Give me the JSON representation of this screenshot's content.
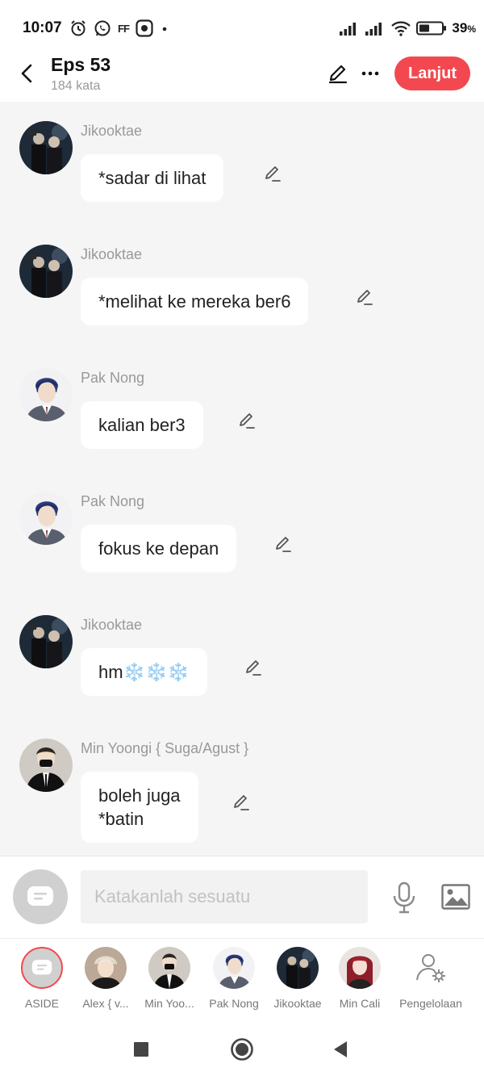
{
  "status_bar": {
    "time": "10:07",
    "left_icons": [
      "alarm-icon",
      "whatsapp-icon",
      "ff-icon",
      "screen-record-icon",
      "dot-icon"
    ],
    "ff_text": "FF",
    "battery_percent": "39",
    "battery_suffix": "%",
    "right_icons": [
      "signal-icon",
      "signal-icon",
      "wifi-icon",
      "battery-icon"
    ]
  },
  "header": {
    "title": "Eps 53",
    "subtitle": "184 kata",
    "continue_label": "Lanjut",
    "accent_color": "#f3484f"
  },
  "messages": [
    {
      "sender": "Jikooktae",
      "text": "*sadar di lihat",
      "avatar": "jikooktae"
    },
    {
      "sender": "Jikooktae",
      "text": "*melihat ke mereka ber6",
      "avatar": "jikooktae"
    },
    {
      "sender": "Pak Nong",
      "text": "kalian ber3",
      "avatar": "paknong"
    },
    {
      "sender": "Pak Nong",
      "text": "fokus ke depan",
      "avatar": "paknong"
    },
    {
      "sender": "Jikooktae",
      "text": "hm❄️❄️❄️",
      "avatar": "jikooktae"
    },
    {
      "sender": "Min Yoongi { Suga/Agust }",
      "text": "boleh juga\n*batin",
      "avatar": "yoongi"
    }
  ],
  "input": {
    "placeholder": "Katakanlah sesuatu",
    "value": ""
  },
  "characters": [
    {
      "label": "ASIDE",
      "avatar": "aside"
    },
    {
      "label": "Alex { v...",
      "avatar": "alex"
    },
    {
      "label": "Min Yoo...",
      "avatar": "yoongi"
    },
    {
      "label": "Pak Nong",
      "avatar": "paknong"
    },
    {
      "label": "Jikooktae",
      "avatar": "jikooktae"
    },
    {
      "label": "Min Cali",
      "avatar": "mincali"
    },
    {
      "label": "Pengelolaan",
      "avatar": "manage"
    }
  ]
}
